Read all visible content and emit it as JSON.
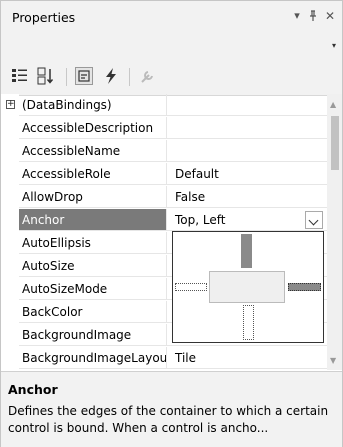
{
  "window": {
    "title": "Properties",
    "menu_glyph": "▾",
    "pin_glyph": "ᚬ",
    "close_glyph": "✕",
    "selector_arrow": "▾"
  },
  "toolbar": {
    "tools": [
      {
        "name": "categorized-icon",
        "enabled": true
      },
      {
        "name": "alphabetical-icon",
        "enabled": true
      },
      {
        "name": "properties-icon",
        "enabled": true
      },
      {
        "name": "events-icon",
        "enabled": true
      },
      {
        "name": "property-pages-icon",
        "enabled": false
      }
    ]
  },
  "grid": {
    "rows": [
      {
        "name": "(DataBindings)",
        "value": "",
        "expander": "+"
      },
      {
        "name": "AccessibleDescription",
        "value": ""
      },
      {
        "name": "AccessibleName",
        "value": ""
      },
      {
        "name": "AccessibleRole",
        "value": "Default"
      },
      {
        "name": "AllowDrop",
        "value": "False"
      },
      {
        "name": "Anchor",
        "value": "Top, Left",
        "selected": true
      },
      {
        "name": "AutoEllipsis",
        "value": ""
      },
      {
        "name": "AutoSize",
        "value": ""
      },
      {
        "name": "AutoSizeMode",
        "value": ""
      },
      {
        "name": "BackColor",
        "value": ""
      },
      {
        "name": "BackgroundImage",
        "value": ""
      },
      {
        "name": "BackgroundImageLayout",
        "value": "Tile"
      }
    ],
    "scroll_up_glyph": "▲",
    "scroll_down_glyph": "▼"
  },
  "anchor_editor": {
    "top": true,
    "left": true,
    "right": false,
    "bottom": false
  },
  "description": {
    "title": "Anchor",
    "text": "Defines the edges of the container to which a certain control is bound. When a control is ancho..."
  },
  "colors": {
    "selection": "#7a7a7a",
    "panel_bg": "#f2f2f2"
  }
}
